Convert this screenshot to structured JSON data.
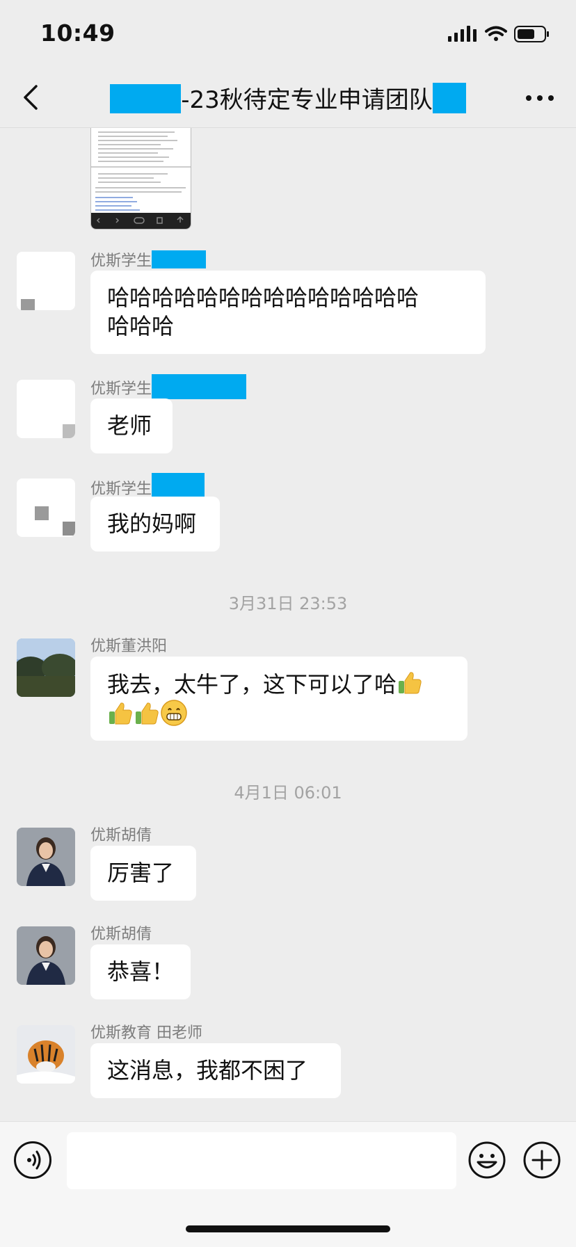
{
  "status_bar": {
    "time": "10:49"
  },
  "header": {
    "title": "-23秋待定专业申请团队",
    "back_icon": "chevron-left-icon",
    "more_icon": "more-dots-icon"
  },
  "messages": [
    {
      "sender": "优斯学生",
      "text_line1": "哈哈哈哈哈哈哈哈哈哈哈哈哈哈",
      "text_line2": "哈哈哈"
    },
    {
      "sender": "优斯学生",
      "text": "老师"
    },
    {
      "sender": "优斯学生",
      "text": "我的妈啊"
    },
    {
      "sender": "优斯董洪阳",
      "text": "我去，太牛了，这下可以了哈"
    },
    {
      "sender": "优斯胡倩",
      "text": "厉害了"
    },
    {
      "sender": "优斯胡倩",
      "text": "恭喜！"
    },
    {
      "sender": "优斯教育 田老师",
      "text": "这消息，我都不困了"
    }
  ],
  "timestamps": [
    "3月31日 23:53",
    "4月1日 06:01"
  ],
  "emojis": [
    "thumbs-up",
    "thumbs-up",
    "thumbs-up",
    "grinning-face"
  ],
  "bottom_bar": {
    "voice_icon": "voice-icon",
    "emoji_icon": "emoji-icon",
    "plus_icon": "plus-icon",
    "input_value": ""
  },
  "colors": {
    "background": "#ededed",
    "bubble": "#ffffff",
    "mask": "#00aaf0",
    "meta_text": "#7d7d7d"
  }
}
